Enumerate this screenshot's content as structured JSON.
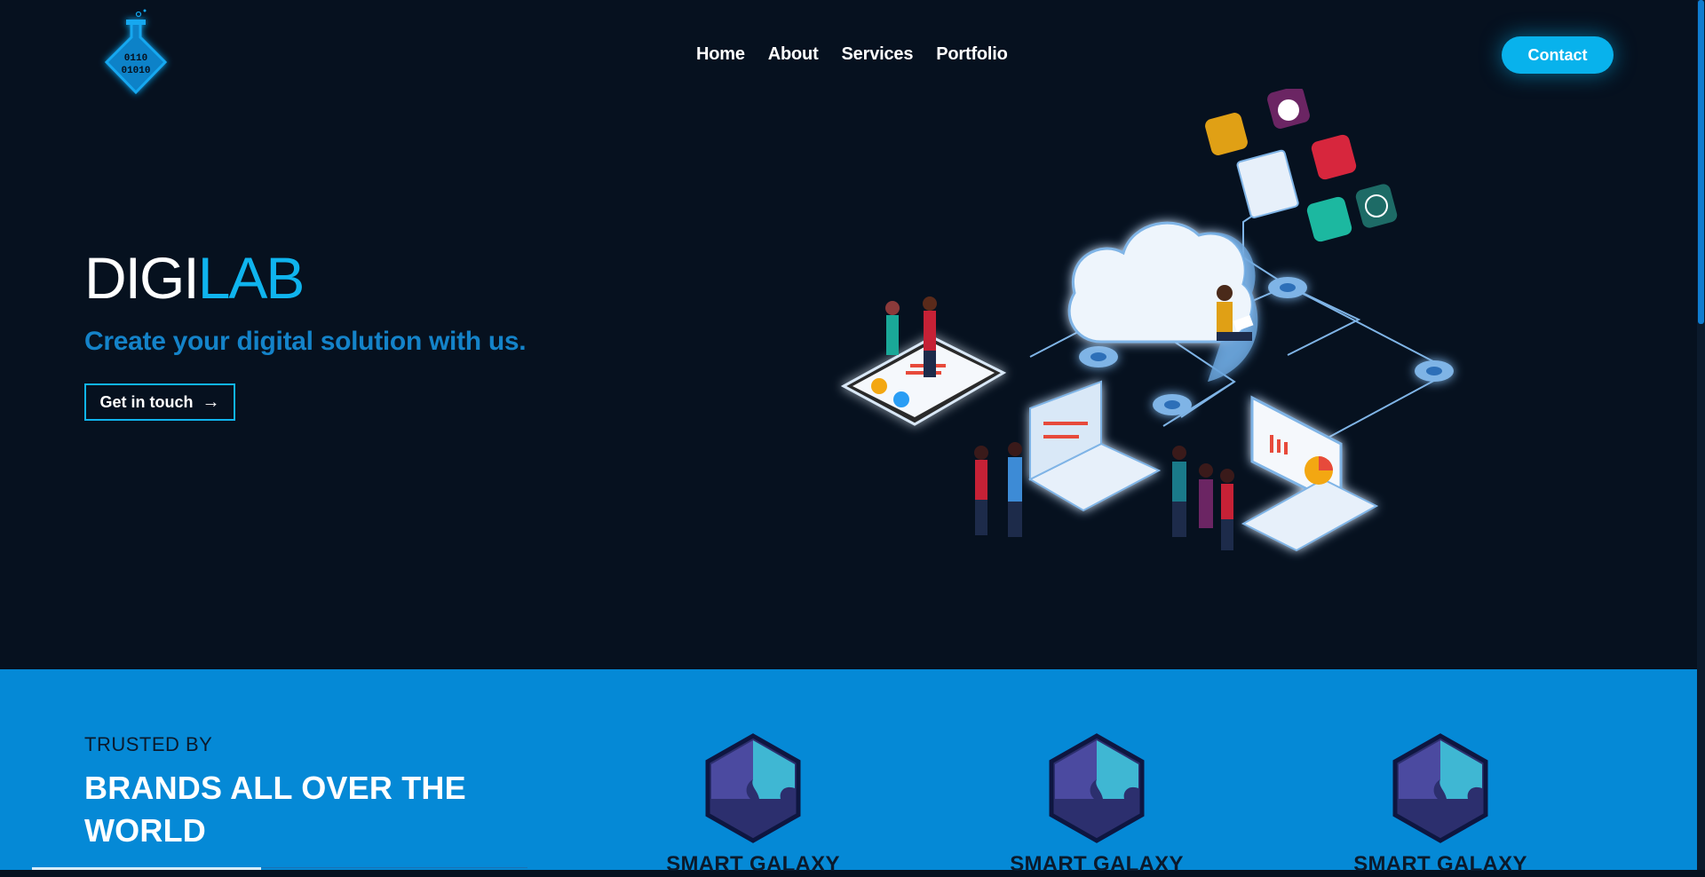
{
  "nav": {
    "items": [
      {
        "label": "Home"
      },
      {
        "label": "About"
      },
      {
        "label": "Services"
      },
      {
        "label": "Portfolio"
      }
    ],
    "contact_label": "Contact"
  },
  "logo": {
    "digits_line1": "0110",
    "digits_line2": "01010"
  },
  "hero": {
    "title_part1": "DIGI",
    "title_part2": "LAB",
    "subtitle": "Create your digital solution with us.",
    "cta_label": "Get in touch",
    "cta_arrow": "→"
  },
  "brands": {
    "eyebrow": "TRUSTED BY",
    "title": "BRANDS ALL OVER THE WORLD",
    "logos": [
      {
        "name": "SMART GALAXY"
      },
      {
        "name": "SMART GALAXY"
      },
      {
        "name": "SMART GALAXY"
      }
    ]
  },
  "colors": {
    "background": "#06111f",
    "accent": "#0fb4ee",
    "subtitle": "#1483c9",
    "brand_band": "#0589d6"
  }
}
